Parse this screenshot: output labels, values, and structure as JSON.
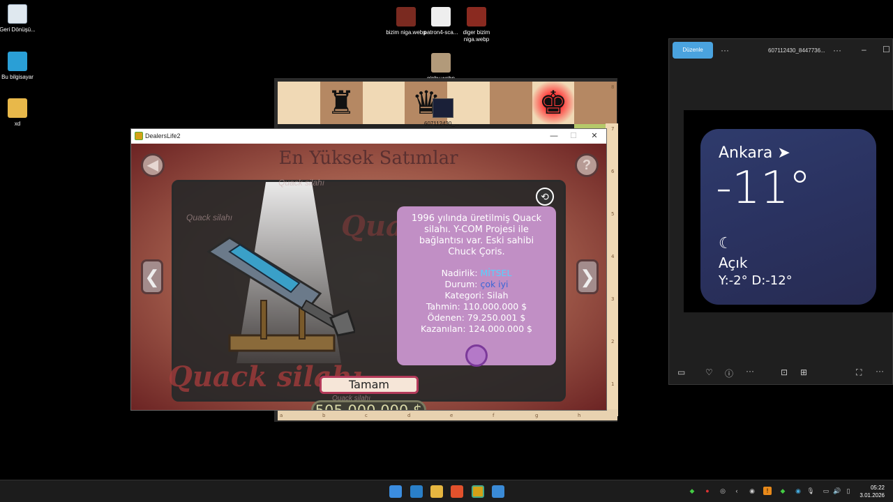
{
  "desktop": {
    "icons": [
      {
        "label": "Geri Dönüşü..."
      },
      {
        "label": "Bu bilgisayar"
      },
      {
        "label": "xd"
      },
      {
        "label": "bizim niga.webp"
      },
      {
        "label": "patron4-sca..."
      },
      {
        "label": "diger bizim niga.webp"
      },
      {
        "label": "giphy.webp"
      }
    ],
    "overlay_label": "607112430_..."
  },
  "chess": {
    "ranks": [
      "8",
      "7",
      "6",
      "5",
      "4",
      "3",
      "2",
      "1"
    ],
    "files": [
      "a",
      "b",
      "c",
      "d",
      "e",
      "f",
      "g",
      "h"
    ]
  },
  "game_window": {
    "title": "DealersLife2",
    "headline": "En Yüksek Satımlar",
    "ghost_subtitle": "Quack silahı",
    "ghost_left_label": "Quack silahı",
    "ghost_big": "Quac",
    "ghost_bottom": "Quack silahı",
    "ghost_under_money": "Quack silahı",
    "description": "1996 yılında üretilmiş Quack silahı. Y-COM Projesi ile bağlantısı var. Eski sahibi Chuck Çoris.",
    "rarity_label": "Nadirlik:",
    "rarity_value": "MİTSEL",
    "condition_label": "Durum:",
    "condition_value": "çok iyi",
    "category": "Kategori: Silah",
    "estimate": "Tahmin: 110.000.000 $",
    "paid": "Ödenen: 79.250.001 $",
    "earned": "Kazanılan: 124.000.000 $",
    "ok_button": "Tamam",
    "money": "505.000.000 $",
    "back_icon": "◀",
    "help_icon": "?",
    "share_icon": "share-icon",
    "prev_icon": "❮",
    "next_icon": "❯"
  },
  "viewer": {
    "edit_button": "Düzenle",
    "filename": "607112430_8447736...",
    "weather": {
      "city": "Ankara",
      "temperature": "-11°",
      "condition": "Açık",
      "range": "Y:-2° D:-12°"
    }
  },
  "taskbar": {
    "time": "05:22",
    "date": "3.01.2026"
  },
  "colors": {
    "info_box": "#c18fc5",
    "rarity": "#55d3ff",
    "ok_border": "#b43a5a",
    "edit_button": "#4aa3df"
  }
}
